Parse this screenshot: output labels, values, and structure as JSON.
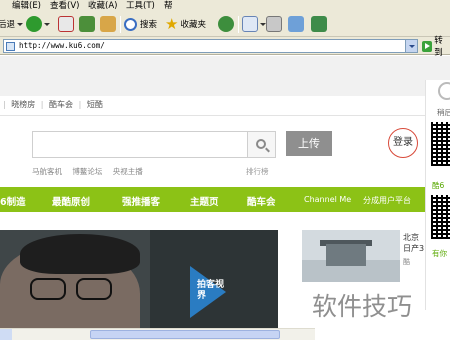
{
  "menubar": {
    "items": [
      "编辑(E)",
      "查看(V)",
      "收藏(A)",
      "工具(T)",
      "帮"
    ]
  },
  "toolbar": {
    "back_label": "后退",
    "search_label": "搜索",
    "favorites_label": "收藏夹"
  },
  "address": {
    "url": "http://www.ku6.com/",
    "go_label": "转到"
  },
  "site": {
    "topnav": [
      "",
      "|",
      "晓榜房",
      "|",
      "酷车会",
      "|",
      "短酷"
    ],
    "search_placeholder": "",
    "upload_label": "上传",
    "login_label": "登录",
    "hotwords": [
      "马航客机",
      "博鳌论坛",
      "央视主播"
    ],
    "rank_link": "排行榜",
    "nav": [
      "6制造",
      "最酷原创",
      "强推播客",
      "主题页",
      "酷车会",
      "Channel Me",
      "分成用户平台"
    ],
    "hero_badge": "拍客视界",
    "side_news_title": "北京",
    "side_news_line2": "日产3",
    "side_news_meta": "酷",
    "side_panel": {
      "top_label": "稍后",
      "mid_label": "酷6",
      "bottom_label": "有你"
    }
  },
  "watermark": "软件技巧",
  "colors": {
    "chrome": "#ece9d8",
    "nav_green": "#8cc216",
    "upload_gray": "#8f8f8f",
    "login_ring": "#d84a3a"
  }
}
